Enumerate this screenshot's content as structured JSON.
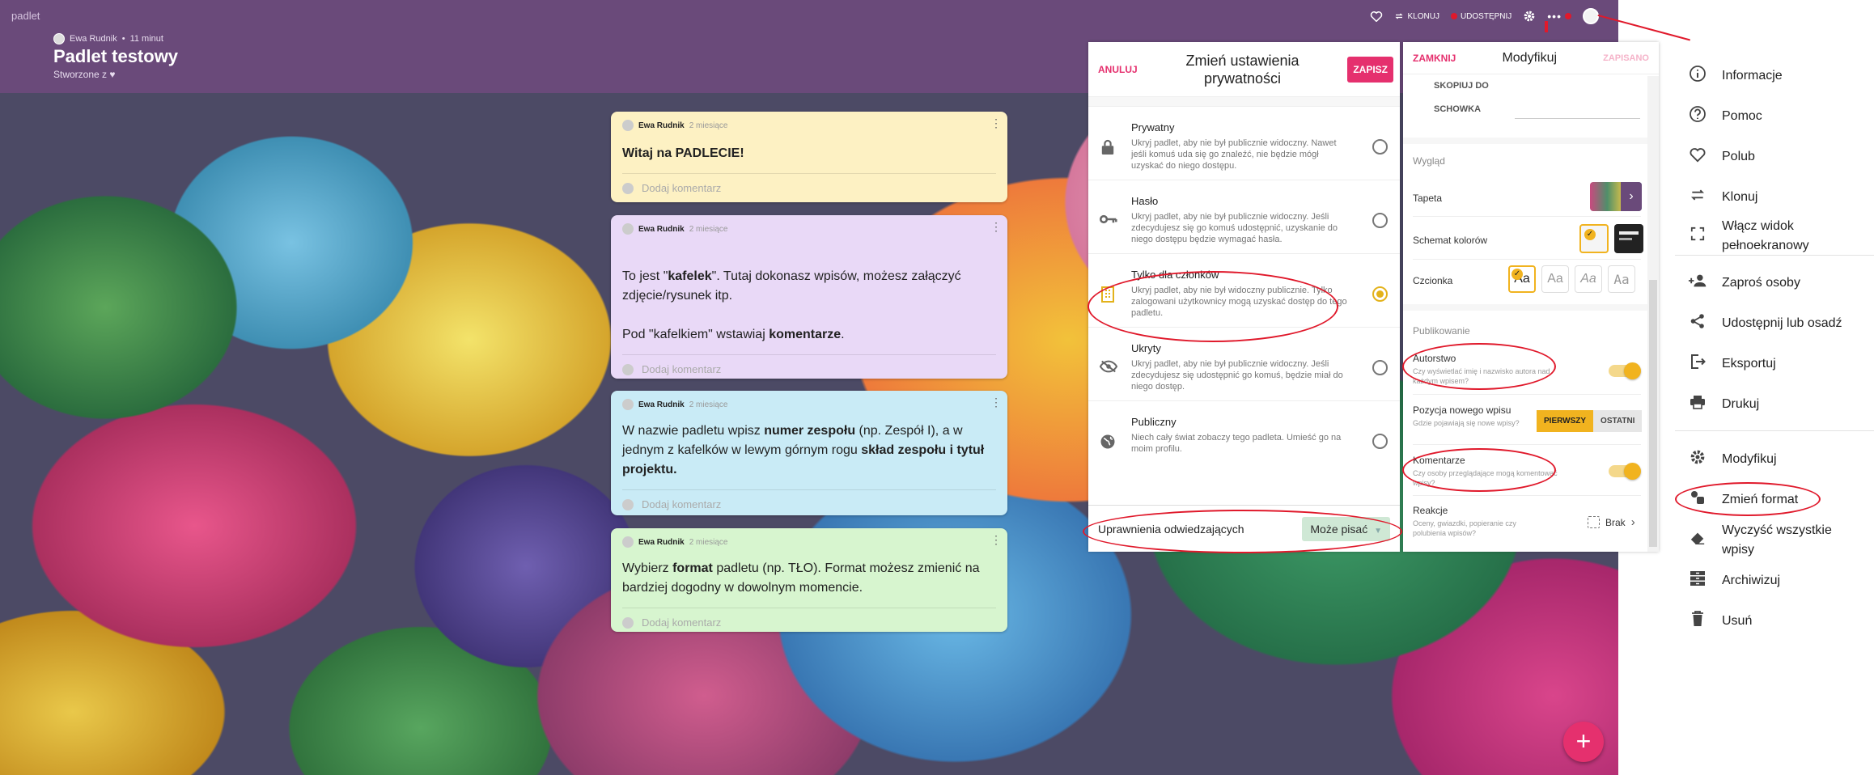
{
  "topbar": {
    "brand": "padlet",
    "author": "Ewa Rudnik",
    "time_ago": "11 minut",
    "title": "Padlet testowy",
    "subtitle": "Stworzone z ♥",
    "actions": {
      "clone": "KLONUJ",
      "share": "UDOSTĘPNIJ"
    }
  },
  "posts": [
    {
      "author": "Ewa Rudnik",
      "time": "2 miesiące",
      "body_html": "<b>Witaj na PADLECIE!</b>",
      "comment_placeholder": "Dodaj komentarz",
      "color": "#fdf1c3"
    },
    {
      "author": "Ewa Rudnik",
      "time": "2 miesiące",
      "body_html": "<br>To jest \"<b>kafelek</b>\".  Tutaj dokonasz wpisów, możesz załączyć zdjęcie/rysunek itp.<br><br>Pod \"kafelkiem\" wstawiaj <b>komentarze</b>.",
      "comment_placeholder": "Dodaj komentarz",
      "color": "#e9d9f7"
    },
    {
      "author": "Ewa Rudnik",
      "time": "2 miesiące",
      "body_html": "W nazwie padletu wpisz <b>numer zespołu</b> (np. Zespół I), a w jednym z kafelków w lewym górnym rogu <b>skład zespołu i tytuł projektu.</b>",
      "comment_placeholder": "Dodaj komentarz",
      "color": "#c9ebf6"
    },
    {
      "author": "Ewa Rudnik",
      "time": "2 miesiące",
      "body_html": "Wybierz <b>format</b> padletu (np. TŁO). Format możesz zmienić na bardziej dogodny w dowolnym momencie.",
      "comment_placeholder": "Dodaj komentarz",
      "color": "#d7f5cf"
    }
  ],
  "privacy": {
    "cancel": "ANULUJ",
    "title": "Zmień ustawienia prywatności",
    "save": "ZAPISZ",
    "options": [
      {
        "name": "Prywatny",
        "desc": "Ukryj padlet, aby nie był publicznie widoczny. Nawet jeśli komuś uda się go znaleźć, nie będzie mógł uzyskać do niego dostępu.",
        "icon": "lock-icon",
        "selected": false
      },
      {
        "name": "Hasło",
        "desc": "Ukryj padlet, aby nie był publicznie widoczny. Jeśli zdecydujesz się go komuś udostępnić, uzyskanie do niego dostępu będzie wymagać hasła.",
        "icon": "key-icon",
        "selected": false
      },
      {
        "name": "Tylko dla członków",
        "desc": "Ukryj padlet, aby nie był widoczny publicznie. Tylko zalogowani użytkownicy mogą uzyskać dostęp do tego padletu.",
        "icon": "building-icon",
        "selected": true
      },
      {
        "name": "Ukryty",
        "desc": "Ukryj padlet, aby nie był publicznie widoczny. Jeśli zdecydujesz się udostępnić go komuś, będzie miał do niego dostęp.",
        "icon": "eye-off-icon",
        "selected": false
      },
      {
        "name": "Publiczny",
        "desc": "Niech cały świat zobaczy tego padleta. Umieść go na moim profilu.",
        "icon": "globe-icon",
        "selected": false
      }
    ],
    "permissions_label": "Uprawnienia odwiedzających",
    "permissions_value": "Może pisać"
  },
  "modify": {
    "close": "ZAMKNIJ",
    "title": "Modyfikuj",
    "saved": "ZAPISANO",
    "copy_line1": "SKOPIUJ DO",
    "copy_line2": "SCHOWKA",
    "section_look": "Wygląd",
    "wallpaper": "Tapeta",
    "color_scheme": "Schemat kolorów",
    "font": "Czcionka",
    "font_sample": "Aa",
    "section_publish": "Publikowanie",
    "authorship": "Autorstwo",
    "authorship_desc": "Czy wyświetlać imię i nazwisko autora nad każdym wpisem?",
    "new_post_position": "Pozycja nowego wpisu",
    "new_post_desc": "Gdzie pojawiają się nowe wpisy?",
    "first": "PIERWSZY",
    "last": "OSTATNI",
    "comments": "Komentarze",
    "comments_desc": "Czy osoby przeglądające mogą komentować wpisy?",
    "reactions": "Reakcje",
    "reactions_desc": "Oceny, gwiazdki, popieranie czy polubienia wpisów?",
    "reactions_value": "Brak"
  },
  "menu": {
    "items": [
      {
        "label": "Informacje",
        "icon": "info-icon"
      },
      {
        "label": "Pomoc",
        "icon": "help-icon"
      },
      {
        "label": "Polub",
        "icon": "heart-icon"
      },
      {
        "label": "Klonuj",
        "icon": "clone-icon"
      },
      {
        "label": "Włącz widok pełnoekranowy",
        "icon": "fullscreen-icon"
      },
      {
        "label": "Zaproś osoby",
        "icon": "add-people-icon"
      },
      {
        "label": "Udostępnij lub osadź",
        "icon": "share-icon"
      },
      {
        "label": "Eksportuj",
        "icon": "export-icon"
      },
      {
        "label": "Drukuj",
        "icon": "print-icon"
      },
      {
        "label": "Modyfikuj",
        "icon": "gear-icon"
      },
      {
        "label": "Zmień format",
        "icon": "format-icon"
      },
      {
        "label": "Wyczyść wszystkie wpisy",
        "icon": "eraser-icon"
      },
      {
        "label": "Archiwizuj",
        "icon": "archive-icon"
      },
      {
        "label": "Usuń",
        "icon": "trash-icon"
      }
    ]
  },
  "colors": {
    "topbar": "#6a4a7a",
    "accent_pink": "#e5306e",
    "accent_yellow": "#f1b31f",
    "annotation_red": "#e0192b"
  }
}
